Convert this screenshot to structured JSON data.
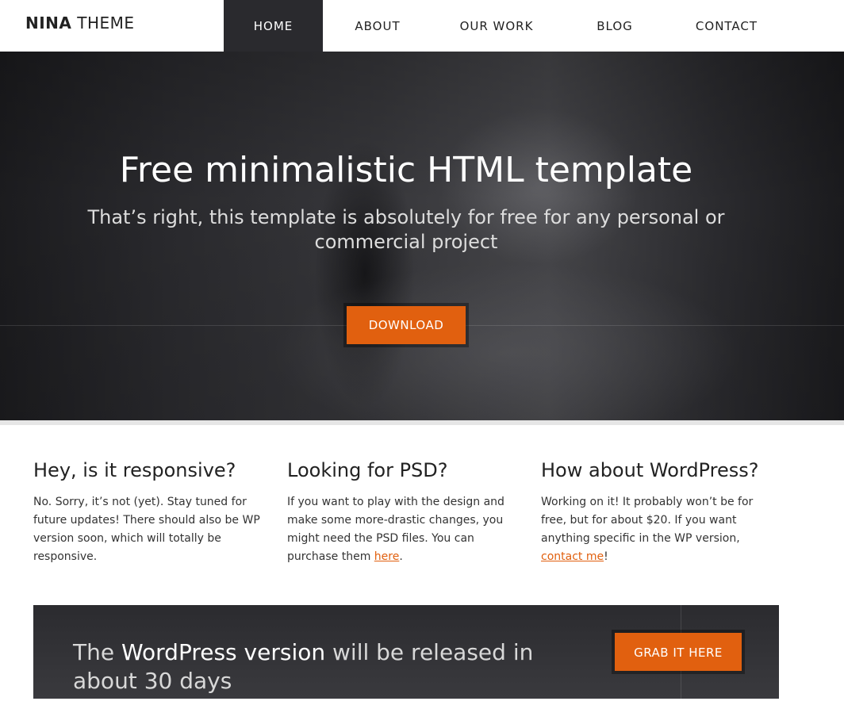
{
  "header": {
    "logo_bold": "NINA",
    "logo_light": "THEME",
    "nav": [
      {
        "label": "HOME",
        "active": true
      },
      {
        "label": "ABOUT",
        "active": false
      },
      {
        "label": "OUR WORK",
        "active": false
      },
      {
        "label": "BLOG",
        "active": false
      },
      {
        "label": "CONTACT",
        "active": false
      }
    ]
  },
  "hero": {
    "title": "Free minimalistic HTML template",
    "subtitle": "That’s right, this template is absolutely for free for any personal or commercial project",
    "button_label": "DOWNLOAD"
  },
  "features": [
    {
      "heading": "Hey, is it responsive?",
      "text": "No. Sorry, it’s not (yet). Stay tuned for future updates! There should also be WP version soon, which will totally be responsive.",
      "link": "",
      "after": ""
    },
    {
      "heading": "Looking for PSD?",
      "text": "If you want to play with the design and make some more-drastic changes, you might need the PSD files. You can purchase them ",
      "link": "here",
      "after": "."
    },
    {
      "heading": "How about WordPress?",
      "text": "Working on it! It probably won’t be for free, but for about $20. If you want anything specific in the WP version, ",
      "link": "contact me",
      "after": "!"
    }
  ],
  "banner": {
    "text_before": "The ",
    "text_highlight": "WordPress version",
    "text_after": " will be released in about 30 days",
    "button_label": "GRAB IT HERE"
  },
  "colors": {
    "accent": "#e1600f",
    "nav_active_bg": "#2a2a2e",
    "banner_bg": "#2b2b2f"
  }
}
